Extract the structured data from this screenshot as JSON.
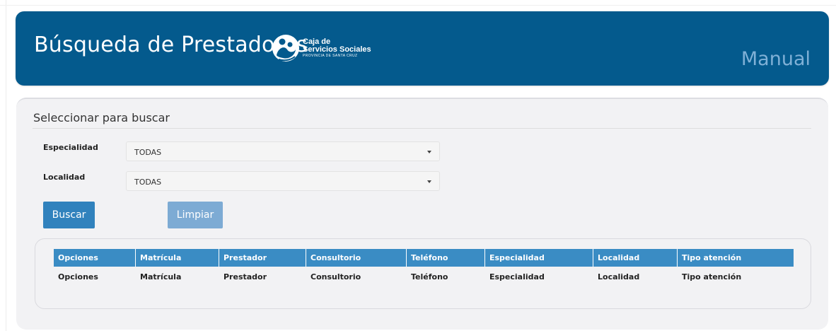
{
  "header": {
    "title": "Búsqueda de Prestadores",
    "logo": {
      "line1": "Caja de",
      "line2": "Servicios Sociales",
      "line3": "PROVINCIA DE SANTA CRUZ"
    },
    "mode": "Manual"
  },
  "form": {
    "section_title": "Seleccionar para buscar",
    "especialidad": {
      "label": "Especialidad",
      "value": "TODAS"
    },
    "localidad": {
      "label": "Localidad",
      "value": "TODAS"
    },
    "buscar_label": "Buscar",
    "limpiar_label": "Limpiar"
  },
  "table": {
    "headers": [
      "Opciones",
      "Matrícula",
      "Prestador",
      "Consultorio",
      "Teléfono",
      "Especialidad",
      "Localidad",
      "Tipo atención"
    ],
    "footer": [
      "Opciones",
      "Matrícula",
      "Prestador",
      "Consultorio",
      "Teléfono",
      "Especialidad",
      "Localidad",
      "Tipo atención"
    ]
  },
  "colors": {
    "header_bg": "#045a8d",
    "primary": "#3182bd",
    "primary_disabled": "#7dabd4",
    "table_head": "#3a8cc4"
  }
}
